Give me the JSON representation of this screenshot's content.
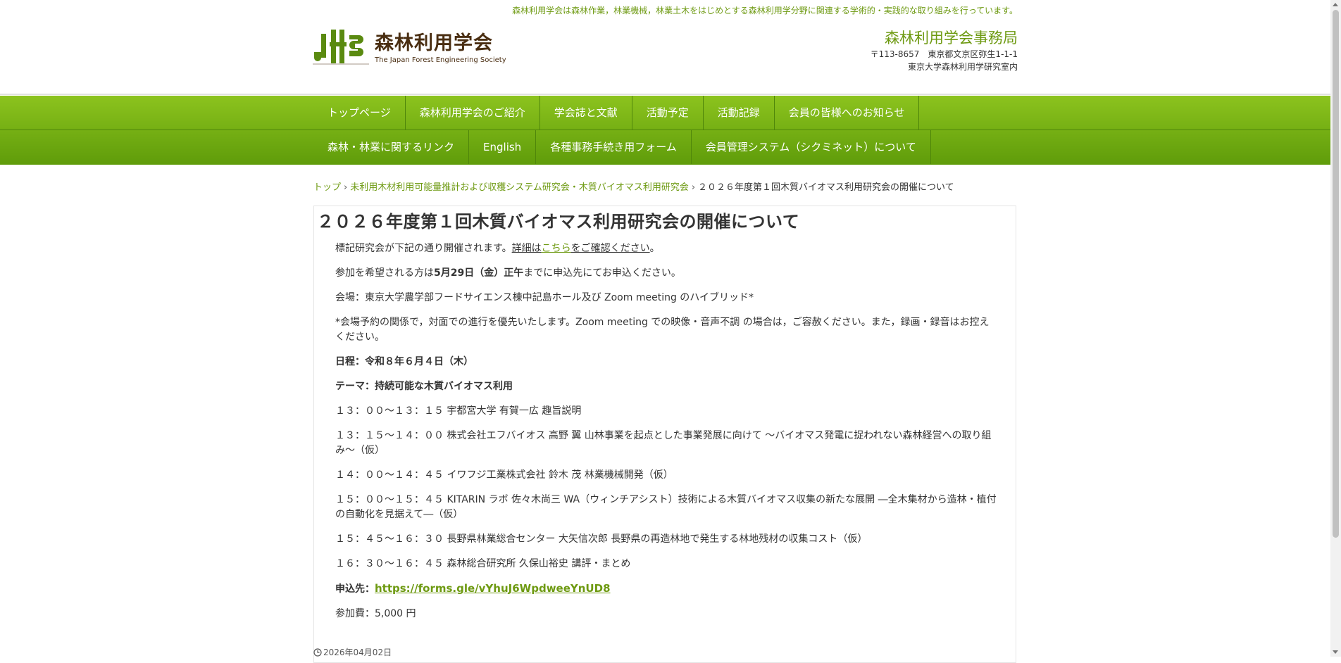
{
  "header": {
    "tagline": "森林利用学会は森林作業，林業機械，林業土木をはじめとする森林利用学分野に関連する学術的・実践的な取り組みを行っています。",
    "logo": {
      "mark": "JFES",
      "title": "森林利用学会",
      "subtitle": "The Japan Forest Engineering Society"
    },
    "office": {
      "name": "森林利用学会事務局",
      "address1": "〒113-8657　東京都文京区弥生1-1-1",
      "address2": "東京大学森林利用学研究室内"
    }
  },
  "nav": {
    "row1": [
      "トップページ",
      "森林利用学会のご紹介",
      "学会誌と文献",
      "活動予定",
      "活動記録",
      "会員の皆様へのお知らせ"
    ],
    "row2": [
      "森林・林業に関するリンク",
      "English",
      "各種事務手続き用フォーム",
      "会員管理システム（シクミネット）について"
    ]
  },
  "breadcrumb": {
    "home": "トップ",
    "sep": "›",
    "category": "未利用木材利用可能量推計および収穫システム研究会・木質バイオマス利用研究会",
    "current": "２０２６年度第１回木質バイオマス利用研究会の開催について"
  },
  "article": {
    "title": "２０２６年度第１回木質バイオマス利用研究会の開催について",
    "intro": {
      "pre": "標記研究会が下記の通り開催されます。",
      "u1": "詳細は",
      "link": "こちら",
      "u2": "をご確認ください",
      "post": "。"
    },
    "apply_notice": {
      "pre": "参加を希望される方は",
      "deadline": "5月29日（金）正午",
      "post": "までに申込先にてお申込ください。"
    },
    "venue": "会場：東京大学農学部フードサイエンス棟中記島ホール及び Zoom meeting のハイブリッド*",
    "note": "*会場予約の関係で，対面での進行を優先いたします。Zoom meeting での映像・音声不調 の場合は，ご容赦ください。また，録画・録音はお控えください。",
    "schedule_date": "日程：令和８年６月４日（木）",
    "theme": "テーマ：持続可能な木質バイオマス利用",
    "program": [
      "１３：００〜１３：１５ 宇都宮大学 有賀一広 趣旨説明",
      "１３：１５〜１４：００ 株式会社エフバイオス 高野 翼 山林事業を起点とした事業発展に向けて 〜バイオマス発電に捉われない森林経営への取り組み〜（仮）",
      "１４：００〜１４：４５ イワフジ工業株式会社 鈴木 茂 林業機械開発（仮）",
      "１５：００〜１５：４５ KITARIN ラボ 佐々木尚三 WA（ウィンチアシスト）技術による木質バイオマス収集の新たな展開 ―全木集材から造林・植付の自動化を見据えて―（仮）",
      "１５：４５〜１６：３０ 長野県林業総合センター 大矢信次郎 長野県の再造林地で発生する林地残材の収集コスト（仮）",
      "１６：３０〜１６：４５ 森林総合研究所 久保山裕史 講評・まとめ"
    ],
    "apply_label": "申込先：",
    "apply_url": "https://forms.gle/vYhuJ6WpdweeYnUD8",
    "fee": "参加費：5,000 円",
    "date": "2026年04月02日"
  },
  "colors": {
    "accent": "#6e9a12",
    "nav_top": "#8cc31e",
    "nav_bottom": "#5f9c0a",
    "logo_text": "#4a2e12"
  }
}
